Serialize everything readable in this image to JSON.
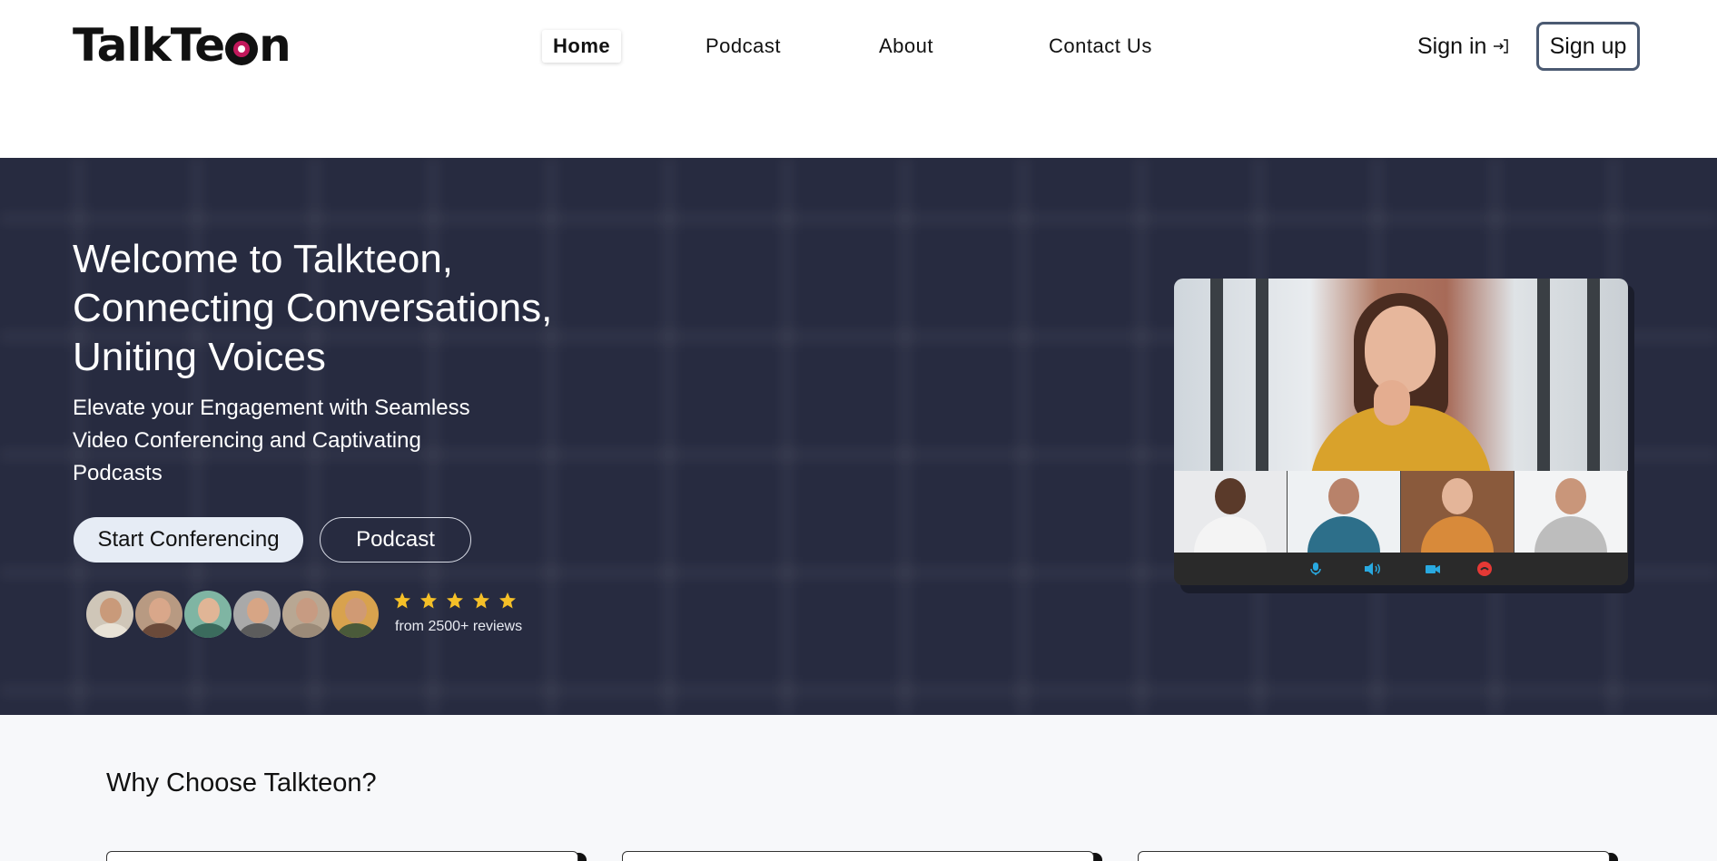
{
  "header": {
    "logo_text_left": "TalkTe",
    "logo_text_right": "n",
    "nav": [
      {
        "label": "Home",
        "active": true
      },
      {
        "label": "Podcast",
        "active": false
      },
      {
        "label": "About",
        "active": false
      },
      {
        "label": "Contact Us",
        "active": false
      }
    ],
    "signin_label": "Sign in",
    "signup_label": "Sign up",
    "signin_icon": "sign-in-arrow-icon"
  },
  "hero": {
    "title_lines": [
      "Welcome to Talkteon,",
      "Connecting Conversations,",
      "Uniting Voices"
    ],
    "subtitle_lines": [
      "Elevate your Engagement with Seamless",
      "Video Conferencing and Captivating",
      "Podcasts"
    ],
    "primary_button": "Start Conferencing",
    "secondary_button": "Podcast",
    "rating_stars": 5,
    "reviews_text": "from 2500+ reviews",
    "star_color": "#f5c028",
    "background_color": "#272b40"
  },
  "video_call": {
    "controls": [
      {
        "icon": "microphone-icon",
        "color": "#29a9e0"
      },
      {
        "icon": "speaker-icon",
        "color": "#29a9e0"
      },
      {
        "icon": "video-camera-icon",
        "color": "#29a9e0"
      },
      {
        "icon": "end-call-icon",
        "color": "#e53935"
      }
    ]
  },
  "why": {
    "title": "Why Choose Talkteon?"
  }
}
